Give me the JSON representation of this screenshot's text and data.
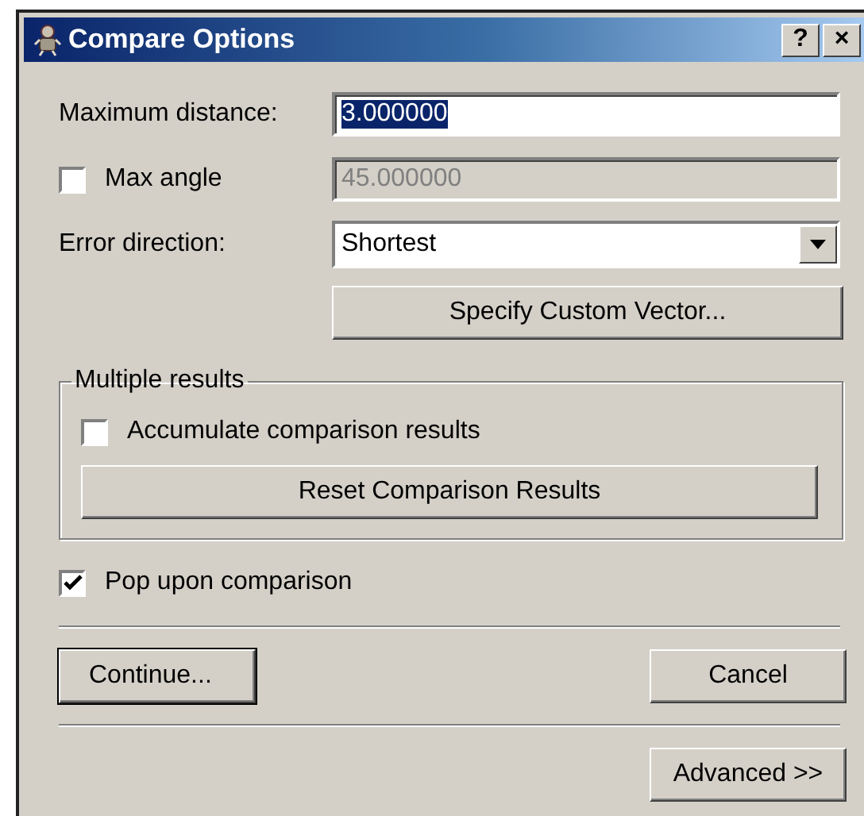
{
  "window": {
    "title": "Compare Options",
    "title_buttons": [
      "?",
      "×"
    ]
  },
  "max_distance": {
    "label": "Maximum distance:",
    "value": "3.000000",
    "text_selected": true,
    "disabled": false
  },
  "max_angle": {
    "label": "Max angle",
    "checked": false,
    "value": "45.000000",
    "disabled": true
  },
  "error_direction": {
    "label": "Error direction:",
    "value": "Shortest"
  },
  "custom_vector_button": {
    "label": "Specify Custom Vector..."
  },
  "multiple_results": {
    "title": "Multiple results",
    "accumulate": {
      "label": "Accumulate comparison results",
      "checked": false
    },
    "reset_button": {
      "label": "Reset Comparison Results"
    }
  },
  "pop": {
    "label": "Pop upon comparison",
    "checked": true
  },
  "buttons": [
    {
      "label": "Continue...",
      "default": true
    },
    {
      "label": "Cancel",
      "default": false
    }
  ],
  "advanced_button": {
    "label": "Advanced >>"
  }
}
